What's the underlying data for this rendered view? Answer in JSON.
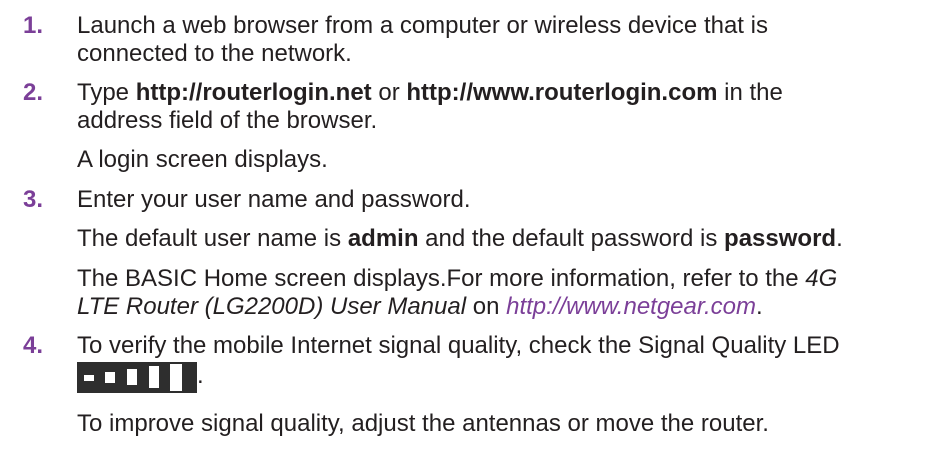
{
  "steps": [
    {
      "number": "1.",
      "line1": "Launch a web browser from a computer or wireless device that is",
      "line2": "connected to the network."
    },
    {
      "number": "2.",
      "line1_a": "Type ",
      "url1": "http://routerlogin.net",
      "line1_b": " or ",
      "url2": "http://www.routerlogin.com",
      "line1_c": " in the",
      "line2": "address field of the browser.",
      "result": "A login screen displays."
    },
    {
      "number": "3.",
      "line1": "Enter your user name and password.",
      "default_a": "The default user name is ",
      "default_user": "admin",
      "default_b": " and the default password is ",
      "default_pass": "password",
      "default_c": ".",
      "info_a": "The BASIC Home screen displays.For more information, refer to the ",
      "info_manual_1": "4G",
      "info_manual_2": "LTE Router (LG2200D) User Manual",
      "info_b": " on ",
      "info_link": "http://www.netgear.com",
      "info_c": "."
    },
    {
      "number": "4.",
      "line1": "To verify the mobile Internet signal quality, check the Signal Quality LED",
      "led_icon": "signal-quality-led-icon",
      "led_period": ".",
      "line3": "To improve signal quality, adjust the antennas or move the router."
    }
  ],
  "colors": {
    "accent": "#7b3f98",
    "text": "#231f20"
  }
}
